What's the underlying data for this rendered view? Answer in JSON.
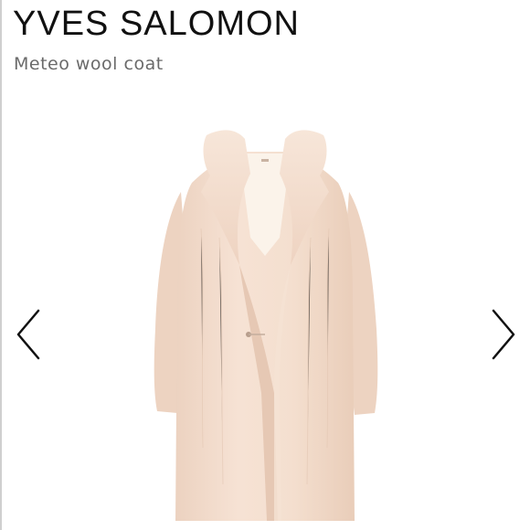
{
  "header": {
    "brand": "YVES SALOMON",
    "product_name": "Meteo wool coat"
  },
  "carousel": {
    "prev_icon": "chevron-left-icon",
    "next_icon": "chevron-right-icon"
  },
  "colors": {
    "brand_text": "#111111",
    "subtitle_text": "#6a6a6a",
    "coat_base": "#f3dccb",
    "arrow": "#111111"
  }
}
